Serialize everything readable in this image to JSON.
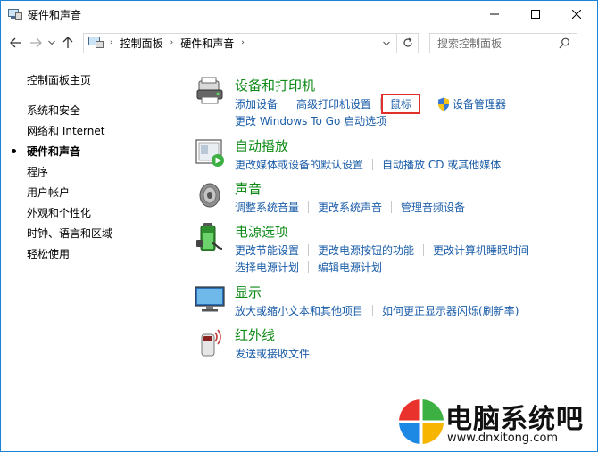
{
  "window": {
    "title": "硬件和声音"
  },
  "address": {
    "crumbs": [
      "控制面板",
      "硬件和声音"
    ]
  },
  "search": {
    "placeholder": "搜索控制面板"
  },
  "leftnav": {
    "items": [
      "控制面板主页",
      "系统和安全",
      "网络和 Internet",
      "硬件和声音",
      "程序",
      "用户帐户",
      "外观和个性化",
      "时钟、语言和区域",
      "轻松使用"
    ],
    "current_index": 3
  },
  "sections": {
    "devices": {
      "title": "设备和打印机",
      "links": [
        "添加设备",
        "高级打印机设置",
        "鼠标",
        "设备管理器"
      ],
      "links2": [
        "更改 Windows To Go 启动选项"
      ]
    },
    "autoplay": {
      "title": "自动播放",
      "links": [
        "更改媒体或设备的默认设置",
        "自动播放 CD 或其他媒体"
      ]
    },
    "sound": {
      "title": "声音",
      "links": [
        "调整系统音量",
        "更改系统声音",
        "管理音频设备"
      ]
    },
    "power": {
      "title": "电源选项",
      "links": [
        "更改节能设置",
        "更改电源按钮的功能",
        "更改计算机睡眠时间"
      ],
      "links2": [
        "选择电源计划",
        "编辑电源计划"
      ]
    },
    "display": {
      "title": "显示",
      "links": [
        "放大或缩小文本和其他项目",
        "如何更正显示器闪烁(刷新率)"
      ]
    },
    "infrared": {
      "title": "红外线",
      "links": [
        "发送或接收文件"
      ]
    }
  },
  "highlight_color": "#e0302a",
  "watermark": {
    "name": "电脑系统吧",
    "url": "www.dnxitong.com"
  }
}
